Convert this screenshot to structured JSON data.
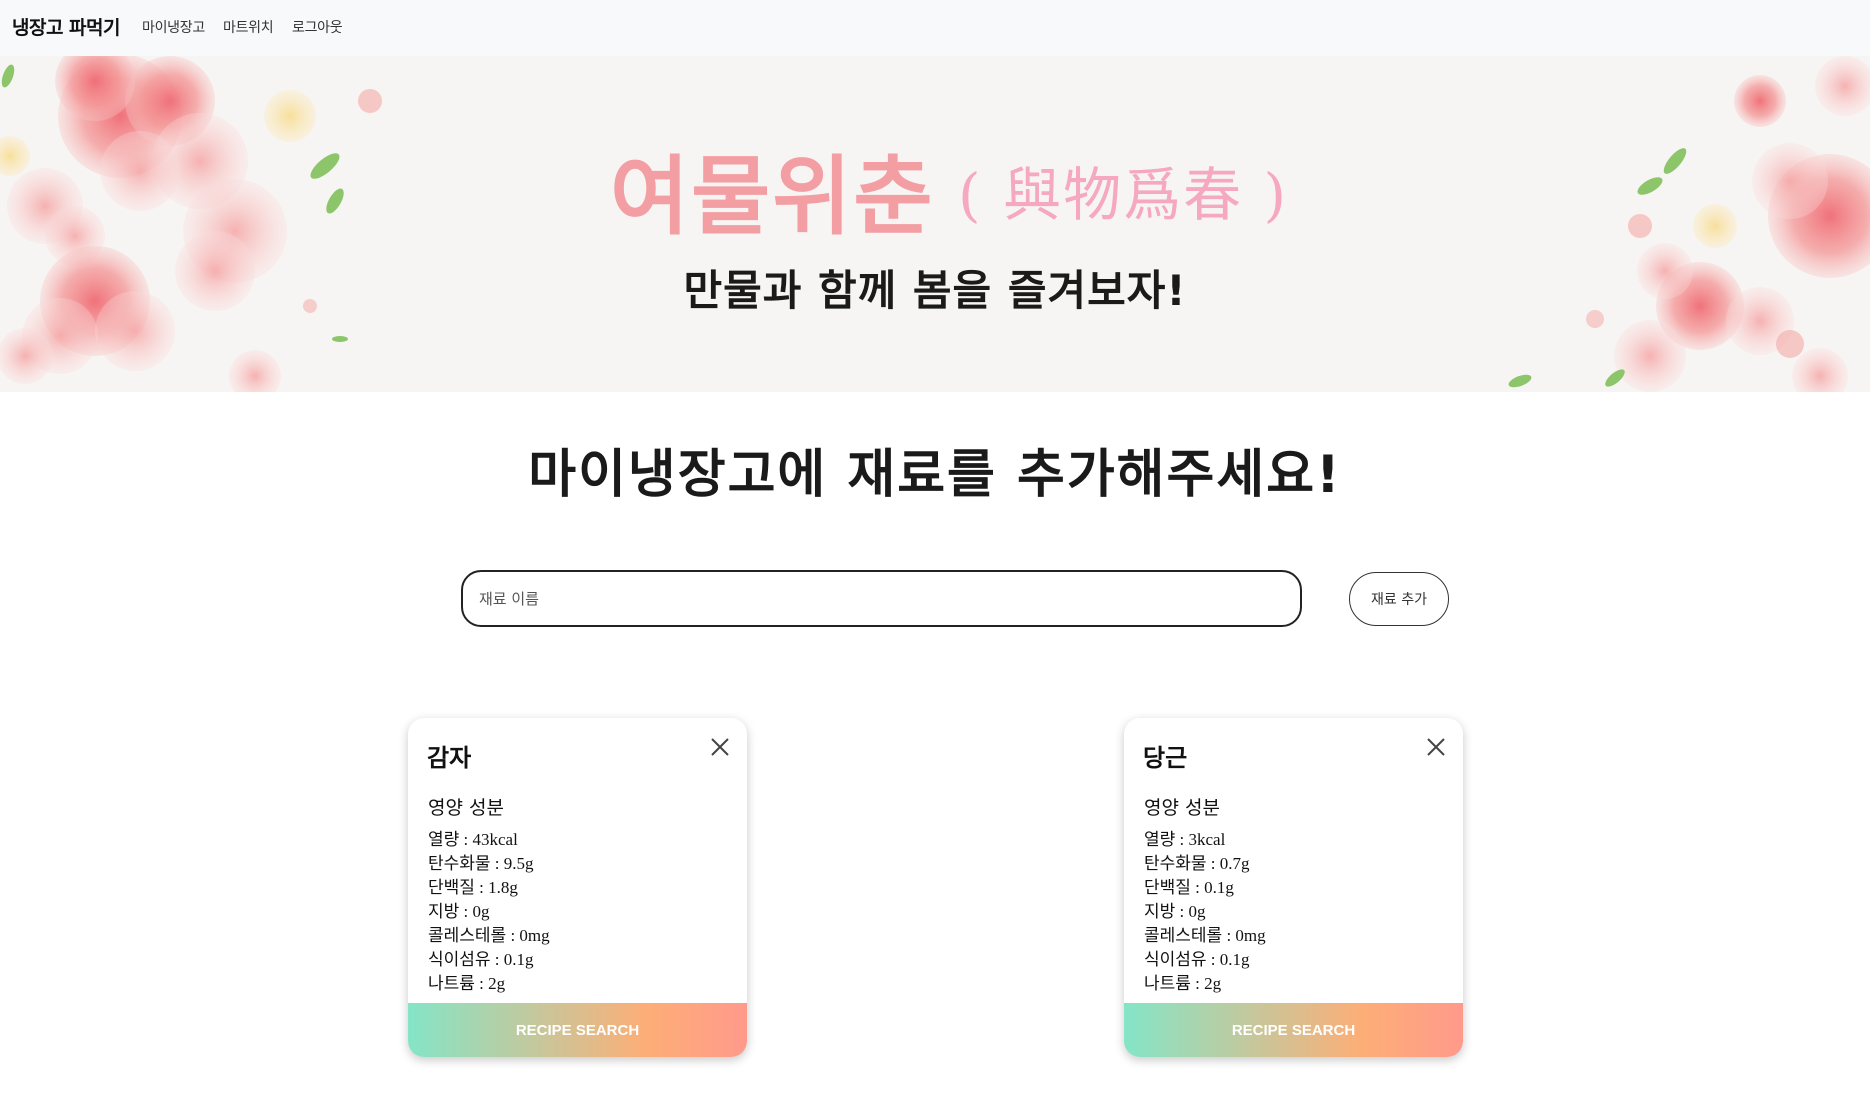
{
  "navbar": {
    "brand": "냉장고 파먹기",
    "links": [
      "마이냉장고",
      "마트위치",
      "로그아웃"
    ]
  },
  "banner": {
    "title": "여물위춘",
    "hanja": "( 與物爲春 )",
    "subtitle": "만물과 함께 봄을 즐겨보자!"
  },
  "main": {
    "heading": "마이냉장고에 재료를 추가해주세요!",
    "input_placeholder": "재료 이름",
    "add_label": "재료 추가"
  },
  "cards": [
    {
      "name": "감자",
      "nutrition_heading": "영양 성분",
      "nutrition": [
        "열량 : 43kcal",
        "탄수화물 : 9.5g",
        "단백질 : 1.8g",
        "지방 : 0g",
        "콜레스테롤 : 0mg",
        "식이섬유 : 0.1g",
        "나트륨 : 2g"
      ],
      "button": "RECIPE SEARCH"
    },
    {
      "name": "당근",
      "nutrition_heading": "영양 성분",
      "nutrition": [
        "열량 : 3kcal",
        "탄수화물 : 0.7g",
        "단백질 : 0.1g",
        "지방 : 0g",
        "콜레스테롤 : 0mg",
        "식이섬유 : 0.1g",
        "나트륨 : 2g"
      ],
      "button": "RECIPE SEARCH"
    }
  ],
  "colors": {
    "banner_title": "#f39ea3",
    "banner_hanja": "#f5a8c0",
    "button_gradient_start": "#84e5c7",
    "button_gradient_end": "#ff9a8b"
  },
  "icons": {
    "card_close": "close-icon",
    "banner_decor": "flower-illustration"
  }
}
